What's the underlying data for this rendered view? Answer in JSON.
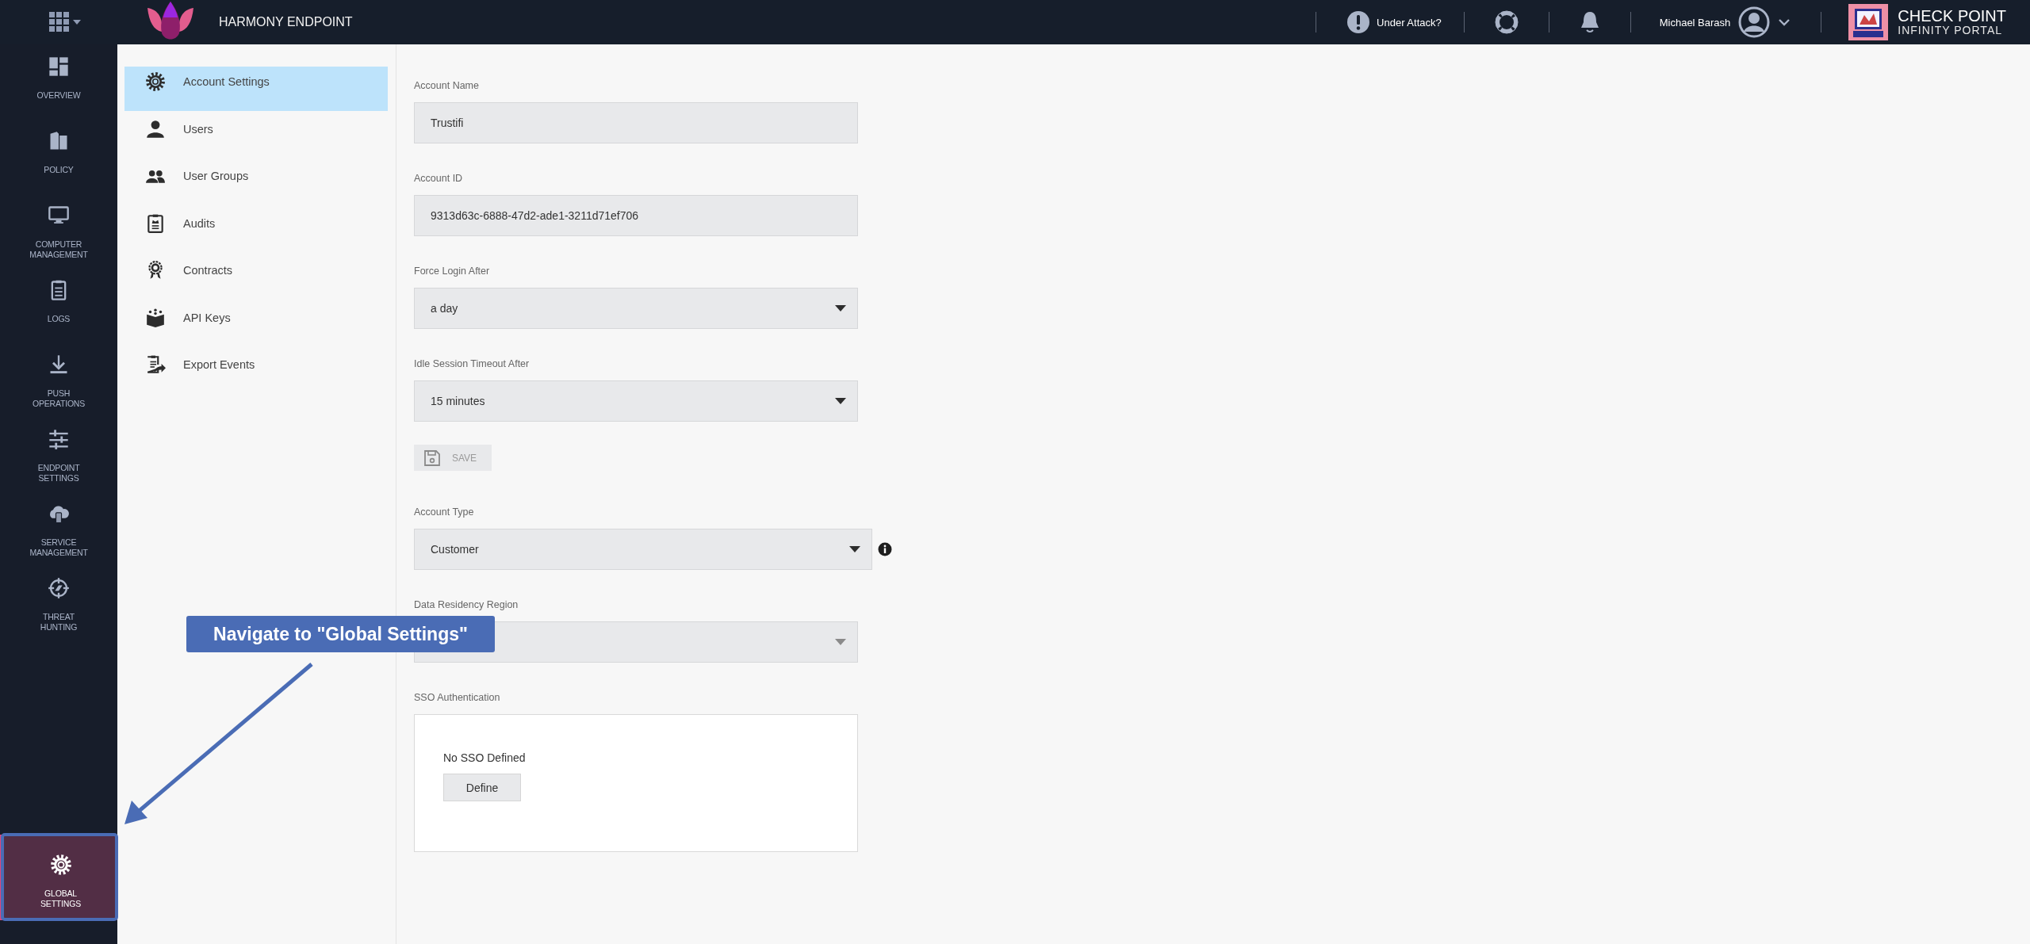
{
  "topbar": {
    "product": "HARMONY ENDPOINT",
    "under_attack": "Under Attack?",
    "user": "Michael Barash",
    "brand_title": "CHECK POINT",
    "brand_subtitle": "INFINITY PORTAL"
  },
  "nav": [
    {
      "label": "OVERVIEW",
      "kind": "overview",
      "selected": false
    },
    {
      "label": "POLICY",
      "kind": "policy",
      "selected": false
    },
    {
      "label": "COMPUTER MANAGEMENT",
      "kind": "computer",
      "selected": false
    },
    {
      "label": "LOGS",
      "kind": "logs",
      "selected": false
    },
    {
      "label": "PUSH OPERATIONS",
      "kind": "push",
      "selected": false
    },
    {
      "label": "ENDPOINT SETTINGS",
      "kind": "sliders",
      "selected": false
    },
    {
      "label": "SERVICE MANAGEMENT",
      "kind": "cloud",
      "selected": false
    },
    {
      "label": "THREAT HUNTING",
      "kind": "target",
      "selected": false
    },
    {
      "label": "GLOBAL SETTINGS",
      "kind": "gear",
      "selected": true
    }
  ],
  "settings_menu": [
    {
      "label": "Account Settings",
      "kind": "gear",
      "selected": true
    },
    {
      "label": "Users",
      "kind": "user",
      "selected": false
    },
    {
      "label": "User Groups",
      "kind": "users",
      "selected": false
    },
    {
      "label": "Audits",
      "kind": "clipboard",
      "selected": false
    },
    {
      "label": "Contracts",
      "kind": "award",
      "selected": false
    },
    {
      "label": "API Keys",
      "kind": "box",
      "selected": false
    },
    {
      "label": "Export Events",
      "kind": "export",
      "selected": false
    }
  ],
  "form": {
    "fields": [
      {
        "kind": "text",
        "label": "Account Name",
        "value": "Trustifi"
      },
      {
        "kind": "text",
        "label": "Account ID",
        "value": "9313d63c-6888-47d2-ade1-3211d71ef706"
      },
      {
        "kind": "select",
        "label": "Force Login After",
        "value": "a day",
        "disabled": false
      },
      {
        "kind": "select",
        "label": "Idle Session Timeout After",
        "value": "15 minutes",
        "disabled": false
      },
      {
        "kind": "save",
        "label": "SAVE",
        "disabled": true
      },
      {
        "kind": "select",
        "label": "Account Type",
        "value": "Customer",
        "disabled": false,
        "info": true
      },
      {
        "kind": "select",
        "label": "Data Residency Region",
        "disabled": true
      },
      {
        "kind": "sso",
        "label": "SSO Authentication",
        "message": "No SSO Defined",
        "button": "Define"
      }
    ]
  },
  "annotation": {
    "text": "Navigate to \"Global Settings\""
  }
}
